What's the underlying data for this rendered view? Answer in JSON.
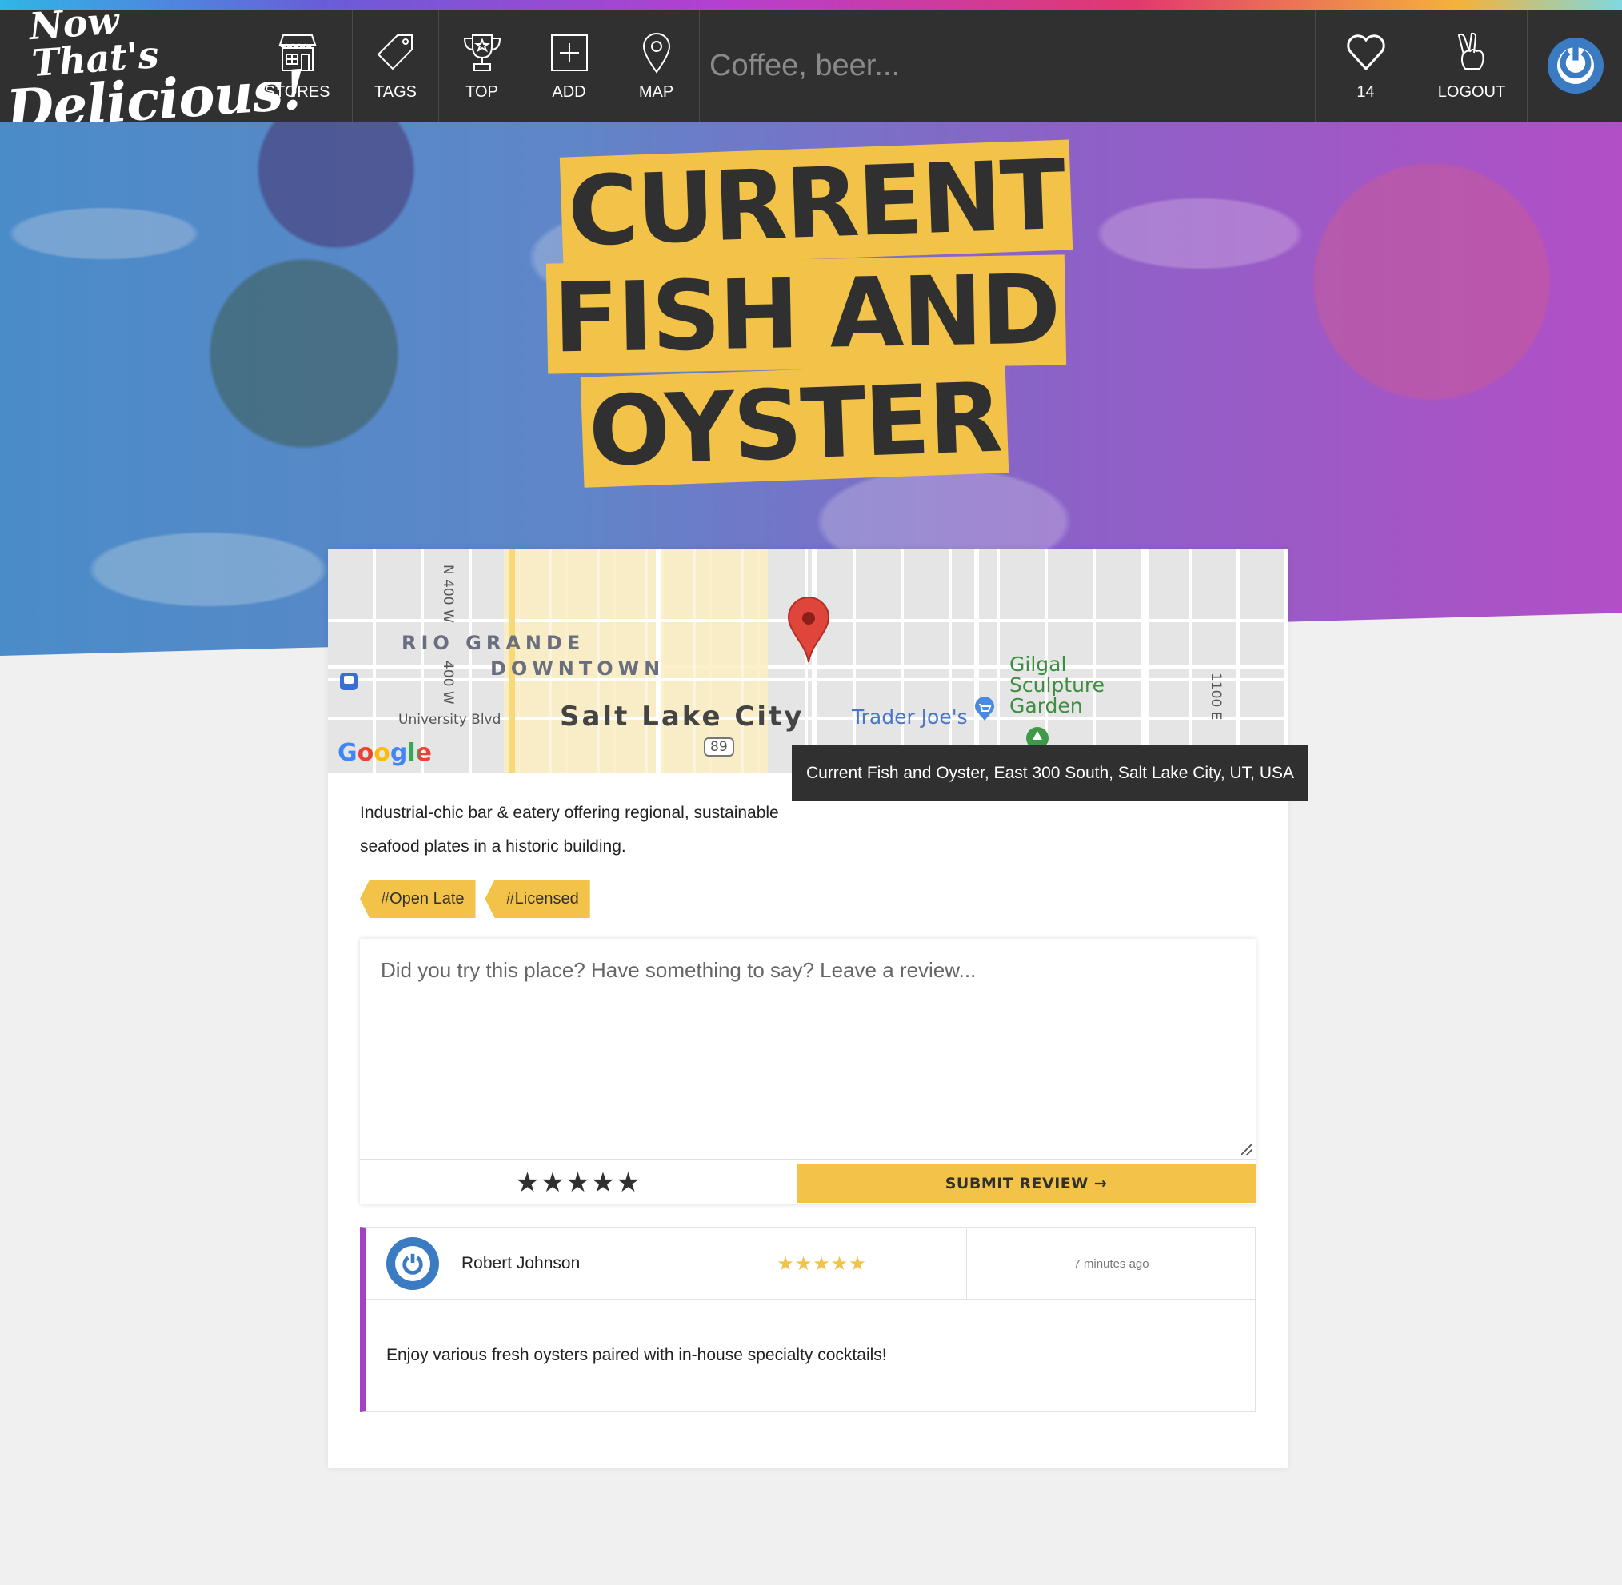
{
  "app": {
    "logo_line1": "Now That's",
    "logo_line2": "Delicious!"
  },
  "nav": {
    "stores": "STORES",
    "tags": "TAGS",
    "top": "TOP",
    "add": "ADD",
    "map": "MAP",
    "search_placeholder": "Coffee, beer...",
    "hearts_count": "14",
    "logout": "LOGOUT"
  },
  "store": {
    "title_lines": [
      "CURRENT",
      "FISH AND",
      "OYSTER"
    ],
    "description": "Industrial-chic bar & eatery offering regional, sustainable seafood plates in a historic building.",
    "tags": [
      "#Open Late",
      "#Licensed"
    ]
  },
  "map": {
    "tooltip": "Current Fish and Oyster, East 300 South, Salt Lake City, UT, USA",
    "district_1": "RIO GRANDE",
    "district_2": "DOWNTOWN",
    "city": "Salt Lake City",
    "street_1": "N 400 W",
    "street_2": "400 W",
    "street_3": "University Blvd",
    "street_4": "1100 E",
    "poi_1": "Gilgal",
    "poi_2": "Sculpture",
    "poi_3": "Garden",
    "poi_4": "Trader Joe's",
    "route": "89",
    "provider": "Google"
  },
  "review_form": {
    "placeholder": "Did you try this place? Have something to say? Leave a review...",
    "stars": "★★★★★",
    "submit_label": "SUBMIT REVIEW →"
  },
  "reviews": [
    {
      "author": "Robert Johnson",
      "stars": "★★★★★",
      "time": "7 minutes ago",
      "text": "Enjoy various fresh oysters paired with in-house specialty cocktails!"
    }
  ],
  "colors": {
    "accent": "#f2c348",
    "nav_bg": "#303030",
    "review_border": "#a53fc8",
    "avatar_blue": "#3a7bc2"
  }
}
